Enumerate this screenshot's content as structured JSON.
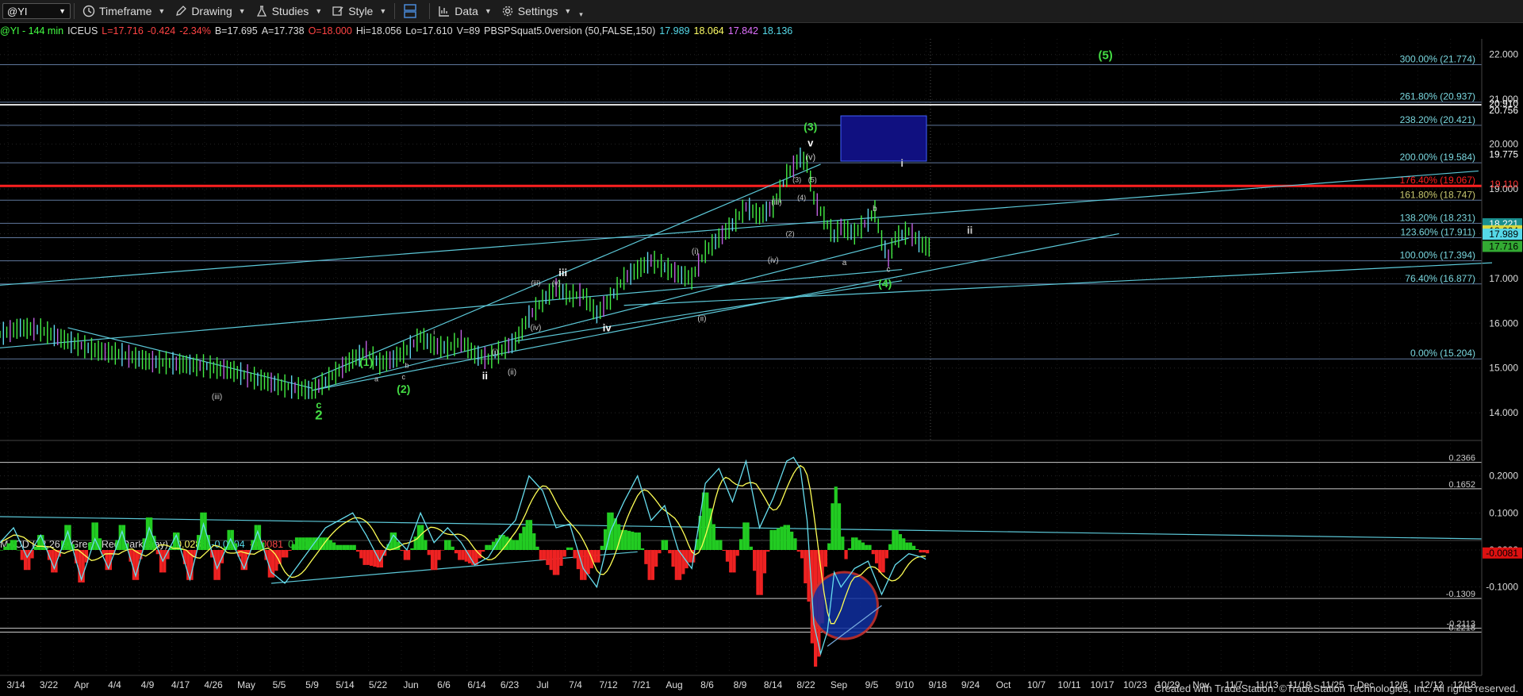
{
  "toolbar": {
    "symbol": "@YI",
    "buttons": [
      {
        "label": "Timeframe",
        "icon": "clock-icon"
      },
      {
        "label": "Drawing",
        "icon": "pencil-icon"
      },
      {
        "label": "Studies",
        "icon": "studies-icon"
      },
      {
        "label": "Style",
        "icon": "style-icon"
      },
      {
        "label": "",
        "icon": "layout-icon"
      },
      {
        "label": "Data",
        "icon": "data-icon"
      },
      {
        "label": "Settings",
        "icon": "gear-icon"
      }
    ]
  },
  "header": {
    "parts": [
      {
        "text": "@YI - 144 min",
        "color": "#44ff44"
      },
      {
        "text": "ICEUS",
        "color": "#dddddd"
      },
      {
        "text": "L=17.716",
        "color": "#ff4444"
      },
      {
        "text": "-0.424",
        "color": "#ff4444"
      },
      {
        "text": "-2.34%",
        "color": "#ff4444"
      },
      {
        "text": "B=17.695",
        "color": "#dddddd"
      },
      {
        "text": "A=17.738",
        "color": "#dddddd"
      },
      {
        "text": "O=18.000",
        "color": "#ff4444"
      },
      {
        "text": "Hi=18.056",
        "color": "#dddddd"
      },
      {
        "text": "Lo=17.610",
        "color": "#dddddd"
      },
      {
        "text": "V=89",
        "color": "#dddddd"
      },
      {
        "text": "PBSPSquat5.0version (50,FALSE,150)",
        "color": "#dddddd"
      },
      {
        "text": "17.989",
        "color": "#55d8e8"
      },
      {
        "text": "18.064",
        "color": "#ffff66"
      },
      {
        "text": "17.842",
        "color": "#e070ff"
      },
      {
        "text": "18.136",
        "color": "#55d8e8"
      }
    ]
  },
  "macd_header": {
    "parts": [
      {
        "text": "MACD (12,26,9,Green,Red,DarkGray)",
        "color": "#dddddd"
      },
      {
        "text": "-0.0285",
        "color": "#ffff66"
      },
      {
        "text": "-0.0204",
        "color": "#55d8e8"
      },
      {
        "text": "-0.0081",
        "color": "#ff4444"
      },
      {
        "text": "0.0000",
        "color": "#44cc44"
      }
    ]
  },
  "chart_data": {
    "type": "candlestick",
    "price_axis": {
      "ylim": [
        13.4,
        22.35
      ],
      "ticks": [
        "14.000",
        "15.000",
        "16.000",
        "17.000",
        "18.000",
        "19.000",
        "20.000",
        "21.000",
        "22.000"
      ]
    },
    "date_axis": [
      "3/14",
      "3/22",
      "Apr",
      "4/4",
      "4/9",
      "4/17",
      "4/26",
      "May",
      "5/5",
      "5/9",
      "5/14",
      "5/22",
      "Jun",
      "6/6",
      "6/14",
      "6/23",
      "Jul",
      "7/4",
      "7/12",
      "7/21",
      "Aug",
      "8/6",
      "8/9",
      "8/14",
      "8/22",
      "Sep",
      "9/5",
      "9/10",
      "9/18",
      "9/24",
      "Oct",
      "10/7",
      "10/11",
      "10/17",
      "10/23",
      "10/29",
      "Nov",
      "11/7",
      "11/13",
      "11/19",
      "11/25",
      "Dec",
      "12/6",
      "12/12",
      "12/18"
    ],
    "price_path": [
      [
        0,
        15.75
      ],
      [
        3,
        15.9
      ],
      [
        6,
        15.85
      ],
      [
        10,
        15.6
      ],
      [
        14,
        15.4
      ],
      [
        18,
        15.3
      ],
      [
        22,
        15.15
      ],
      [
        26,
        15.1
      ],
      [
        30,
        15.05
      ],
      [
        34,
        14.95
      ],
      [
        38,
        14.75
      ],
      [
        42,
        14.6
      ],
      [
        46,
        14.5
      ],
      [
        48,
        14.7
      ],
      [
        50,
        14.95
      ],
      [
        52,
        15.2
      ],
      [
        54,
        15.35
      ],
      [
        56,
        15.1
      ],
      [
        58,
        15.2
      ],
      [
        60,
        15.4
      ],
      [
        62,
        15.7
      ],
      [
        64,
        15.5
      ],
      [
        66,
        15.45
      ],
      [
        68,
        15.6
      ],
      [
        70,
        15.3
      ],
      [
        72,
        15.2
      ],
      [
        74,
        15.4
      ],
      [
        76,
        15.6
      ],
      [
        78,
        16.15
      ],
      [
        80,
        16.5
      ],
      [
        82,
        16.8
      ],
      [
        84,
        16.6
      ],
      [
        86,
        16.65
      ],
      [
        88,
        16.2
      ],
      [
        90,
        16.55
      ],
      [
        92,
        17.0
      ],
      [
        94,
        17.2
      ],
      [
        96,
        17.4
      ],
      [
        98,
        17.25
      ],
      [
        100,
        17.1
      ],
      [
        102,
        17.0
      ],
      [
        104,
        17.6
      ],
      [
        106,
        17.9
      ],
      [
        108,
        18.2
      ],
      [
        110,
        18.6
      ],
      [
        112,
        18.4
      ],
      [
        114,
        18.6
      ],
      [
        116,
        19.3
      ],
      [
        118,
        19.7
      ],
      [
        119,
        19.55
      ],
      [
        120,
        18.8
      ],
      [
        122,
        18.2
      ],
      [
        123,
        17.95
      ],
      [
        124,
        18.15
      ],
      [
        126,
        18.0
      ],
      [
        128,
        18.3
      ],
      [
        129,
        18.5
      ],
      [
        130,
        17.85
      ],
      [
        131,
        17.45
      ],
      [
        132,
        17.9
      ],
      [
        134,
        18.05
      ],
      [
        136,
        17.75
      ],
      [
        137,
        17.7
      ]
    ],
    "fib_levels": [
      {
        "label": "300.00% (21.774)",
        "value": 21.774
      },
      {
        "label": "261.80% (20.937)",
        "value": 20.937
      },
      {
        "label": "238.20% (20.421)",
        "value": 20.421
      },
      {
        "label": "200.00% (19.584)",
        "value": 19.584
      },
      {
        "label": "176.40% (19.067)",
        "value": 19.067
      },
      {
        "label": "161.80% (18.747)",
        "value": 18.747
      },
      {
        "label": "138.20% (18.231)",
        "value": 18.231
      },
      {
        "label": "123.60% (17.911)",
        "value": 17.911
      },
      {
        "label": "100.00% (17.394)",
        "value": 17.394
      },
      {
        "label": "76.40% (16.877)",
        "value": 16.877
      },
      {
        "label": "0.00% (15.204)",
        "value": 15.204
      }
    ],
    "axis_markers": [
      {
        "value": "20.756",
        "price": 20.756,
        "bg": "",
        "fg": "#ffffff"
      },
      {
        "value": "20.910",
        "price": 20.91,
        "bg": "",
        "fg": "#ffffff"
      },
      {
        "value": "19.775",
        "price": 19.775,
        "bg": "",
        "fg": "#ffffff"
      },
      {
        "value": "19.110",
        "price": 19.11,
        "bg": "",
        "fg": "#ff3333"
      },
      {
        "value": "18.221",
        "price": 18.221,
        "bg": "#1a8f8f",
        "fg": "#ffffff"
      },
      {
        "value": "18.064",
        "price": 18.064,
        "bg": "#d8d840",
        "fg": "#000000"
      },
      {
        "value": "17.989",
        "price": 17.989,
        "bg": "#55d8e8",
        "fg": "#000000"
      },
      {
        "value": "17.716",
        "price": 17.716,
        "bg": "#33aa33",
        "fg": "#000000"
      }
    ],
    "wave_labels": [
      {
        "text": "(5)",
        "x": 163,
        "y": 21.9,
        "color": "#44dd44",
        "size": 15
      },
      {
        "text": "(3)",
        "x": 119.5,
        "y": 20.3,
        "color": "#44dd44",
        "size": 14
      },
      {
        "text": "v",
        "x": 119.5,
        "y": 19.95,
        "color": "#ffffff",
        "size": 13
      },
      {
        "text": "(v)",
        "x": 119.5,
        "y": 19.65,
        "color": "#cccccc",
        "size": 11
      },
      {
        "text": "(3)",
        "x": 117.5,
        "y": 19.15,
        "color": "#cccccc",
        "size": 9
      },
      {
        "text": "(5)",
        "x": 119.8,
        "y": 19.15,
        "color": "#cccccc",
        "size": 9
      },
      {
        "text": "(4)",
        "x": 118.2,
        "y": 18.75,
        "color": "#cccccc",
        "size": 9
      },
      {
        "text": "i",
        "x": 133,
        "y": 19.5,
        "color": "#cccccc",
        "size": 13
      },
      {
        "text": "(iii)",
        "x": 114.5,
        "y": 18.65,
        "color": "#cccccc",
        "size": 10
      },
      {
        "text": "b",
        "x": 129,
        "y": 18.5,
        "color": "#cccccc",
        "size": 10
      },
      {
        "text": "(2)",
        "x": 116.5,
        "y": 17.95,
        "color": "#cccccc",
        "size": 9
      },
      {
        "text": "ii",
        "x": 143,
        "y": 18.0,
        "color": "#cccccc",
        "size": 13
      },
      {
        "text": "(iv)",
        "x": 114,
        "y": 17.35,
        "color": "#cccccc",
        "size": 10
      },
      {
        "text": "a",
        "x": 124.5,
        "y": 17.3,
        "color": "#cccccc",
        "size": 10
      },
      {
        "text": "c",
        "x": 131,
        "y": 17.15,
        "color": "#cccccc",
        "size": 10
      },
      {
        "text": "(4)",
        "x": 130.5,
        "y": 16.8,
        "color": "#44dd44",
        "size": 14
      },
      {
        "text": "(i)",
        "x": 102.5,
        "y": 17.55,
        "color": "#cccccc",
        "size": 10
      },
      {
        "text": "iii",
        "x": 83,
        "y": 17.05,
        "color": "#ffffff",
        "size": 13
      },
      {
        "text": "(iii)",
        "x": 79,
        "y": 16.85,
        "color": "#cccccc",
        "size": 9
      },
      {
        "text": "(v)",
        "x": 82,
        "y": 16.85,
        "color": "#cccccc",
        "size": 9
      },
      {
        "text": "(ii)",
        "x": 103.5,
        "y": 16.05,
        "color": "#cccccc",
        "size": 10
      },
      {
        "text": "(iv)",
        "x": 79,
        "y": 15.85,
        "color": "#cccccc",
        "size": 10
      },
      {
        "text": "iv",
        "x": 89.5,
        "y": 15.82,
        "color": "#ffffff",
        "size": 13
      },
      {
        "text": "i",
        "x": 64,
        "y": 15.75,
        "color": "#cccccc",
        "size": 9
      },
      {
        "text": "(i)",
        "x": 73,
        "y": 15.3,
        "color": "#cccccc",
        "size": 10
      },
      {
        "text": "(1)",
        "x": 54,
        "y": 15.05,
        "color": "#44dd44",
        "size": 14
      },
      {
        "text": "b",
        "x": 60,
        "y": 15.0,
        "color": "#cccccc",
        "size": 9
      },
      {
        "text": "(ii)",
        "x": 75.5,
        "y": 14.85,
        "color": "#cccccc",
        "size": 10
      },
      {
        "text": "ii",
        "x": 71.5,
        "y": 14.75,
        "color": "#ffffff",
        "size": 13
      },
      {
        "text": "a",
        "x": 55.5,
        "y": 14.7,
        "color": "#cccccc",
        "size": 9
      },
      {
        "text": "c",
        "x": 59.5,
        "y": 14.75,
        "color": "#cccccc",
        "size": 9
      },
      {
        "text": "(2)",
        "x": 59.5,
        "y": 14.45,
        "color": "#44dd44",
        "size": 14
      },
      {
        "text": "(iii)",
        "x": 32,
        "y": 14.3,
        "color": "#cccccc",
        "size": 10
      },
      {
        "text": "c",
        "x": 47,
        "y": 14.1,
        "color": "#44dd44",
        "size": 13
      },
      {
        "text": "2",
        "x": 47,
        "y": 13.85,
        "color": "#44dd44",
        "size": 17
      }
    ],
    "macd": {
      "ylim": [
        -0.33,
        0.27
      ],
      "ticks": [
        "0.2000",
        "0.1000",
        "0.0000",
        "-0.1000"
      ],
      "levels": [
        0.2366,
        0.1652,
        -0.1309,
        -0.2113,
        -0.2218
      ],
      "level_labels": [
        "0.2366",
        "0.1652",
        "-0.1309",
        "-0.2113",
        "-0.2218"
      ],
      "current": "-0.0081",
      "macd_path": [
        [
          0,
          0.02
        ],
        [
          2,
          0.06
        ],
        [
          4,
          -0.02
        ],
        [
          6,
          0.04
        ],
        [
          8,
          -0.05
        ],
        [
          10,
          0.05
        ],
        [
          12,
          -0.08
        ],
        [
          14,
          0.03
        ],
        [
          16,
          -0.05
        ],
        [
          18,
          0.05
        ],
        [
          20,
          -0.07
        ],
        [
          22,
          0.06
        ],
        [
          24,
          -0.03
        ],
        [
          26,
          0.04
        ],
        [
          28,
          -0.08
        ],
        [
          30,
          0.07
        ],
        [
          32,
          -0.05
        ],
        [
          34,
          0.03
        ],
        [
          36,
          -0.05
        ],
        [
          38,
          0.05
        ],
        [
          40,
          -0.06
        ],
        [
          42,
          -0.09
        ],
        [
          44,
          -0.04
        ],
        [
          46,
          0.01
        ],
        [
          48,
          0.06
        ],
        [
          50,
          0.08
        ],
        [
          52,
          0.1
        ],
        [
          54,
          0.04
        ],
        [
          56,
          -0.03
        ],
        [
          58,
          0.04
        ],
        [
          60,
          0.0
        ],
        [
          62,
          0.1
        ],
        [
          64,
          0.02
        ],
        [
          66,
          0.06
        ],
        [
          68,
          0.02
        ],
        [
          70,
          -0.04
        ],
        [
          72,
          -0.02
        ],
        [
          74,
          0.04
        ],
        [
          76,
          0.08
        ],
        [
          78,
          0.2
        ],
        [
          80,
          0.16
        ],
        [
          82,
          0.06
        ],
        [
          84,
          0.07
        ],
        [
          86,
          -0.05
        ],
        [
          88,
          -0.1
        ],
        [
          90,
          0.05
        ],
        [
          92,
          0.13
        ],
        [
          94,
          0.2
        ],
        [
          96,
          0.08
        ],
        [
          98,
          0.12
        ],
        [
          100,
          0.0
        ],
        [
          102,
          -0.05
        ],
        [
          104,
          0.18
        ],
        [
          106,
          0.22
        ],
        [
          108,
          0.13
        ],
        [
          110,
          0.24
        ],
        [
          112,
          0.06
        ],
        [
          114,
          0.14
        ],
        [
          116,
          0.24
        ],
        [
          117,
          0.25
        ],
        [
          118,
          0.22
        ],
        [
          119,
          0.08
        ],
        [
          120,
          -0.2
        ],
        [
          121,
          -0.28
        ],
        [
          122,
          -0.22
        ],
        [
          123,
          -0.06
        ],
        [
          124,
          -0.1
        ],
        [
          126,
          -0.05
        ],
        [
          128,
          -0.03
        ],
        [
          130,
          -0.12
        ],
        [
          132,
          -0.04
        ],
        [
          134,
          -0.01
        ],
        [
          136,
          -0.02
        ],
        [
          137,
          -0.03
        ]
      ]
    }
  },
  "footer": "Created with TradeStation. ©TradeStation Technologies, Inc. All rights reserved."
}
